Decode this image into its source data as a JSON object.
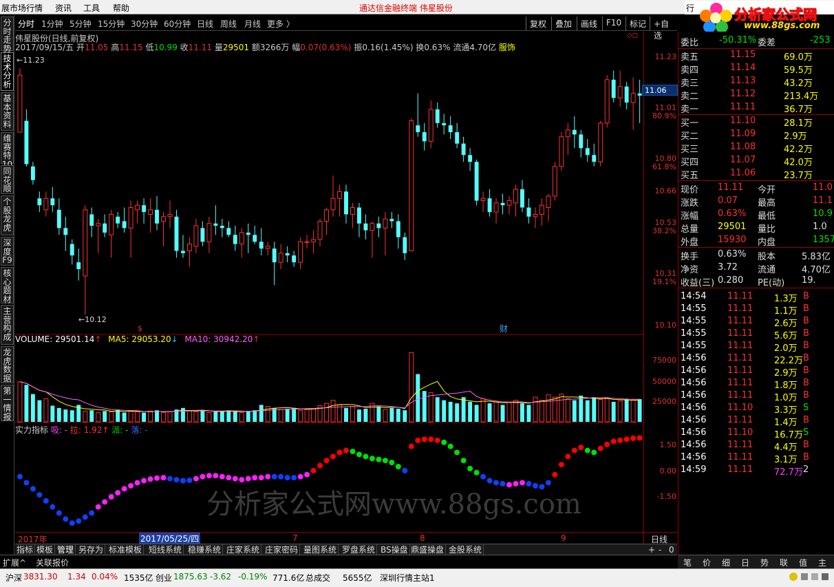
{
  "menubar": {
    "items": [
      "展市场行情",
      "资讯",
      "工具",
      "帮助"
    ],
    "brand": "通达信金融终端  伟星股份",
    "right_label": "行"
  },
  "logo": {
    "title": "分析家公式网",
    "url": "www.88gs.com"
  },
  "left_tabs": [
    "分时走势",
    "技术分析",
    "基本资料",
    "维赛特10",
    "同花顺",
    "个股龙虎",
    "深度F9",
    "核心题材",
    "主营构成",
    "龙虎数据",
    "第一情报"
  ],
  "period_bar": {
    "items": [
      "分时",
      "1分钟",
      "5分钟",
      "15分钟",
      "30分钟",
      "60分钟",
      "日线",
      "周线",
      "月线",
      "更多 〉"
    ],
    "active": "日线",
    "right_items": [
      "复权",
      "叠加",
      "画线",
      "F10",
      "标记",
      "+自选"
    ]
  },
  "chart_header": {
    "title": "伟星股份(日线,前复权)",
    "date": "2017/09/15/五",
    "open_label": "开",
    "open": "11.05",
    "high_label": "高",
    "high": "11.15",
    "low_label": "低",
    "low": "10.99",
    "close_label": "收",
    "close": "11.11",
    "volume_label": "量",
    "volume": "29501",
    "amount": "额3266万",
    "range_label": "幅",
    "range": "0.07(0.63%)",
    "amplitude": "振0.16(1.45%)",
    "turnover": "换0.63%",
    "float_cap": "流通4.70亿",
    "industry": "服饰"
  },
  "chart_data": [
    {
      "type": "candlestick",
      "title": "伟星股份(日线,前复权)",
      "max_label": "11.23",
      "min_label": "10.12",
      "ylim": [
        10.1,
        11.3
      ],
      "axis_ticks": [
        "11.23",
        "11.01",
        "10.80",
        "10.66",
        "10.53",
        "10.31",
        "10.10"
      ],
      "fib_ticks": [
        "80.9%",
        "61.8%",
        "38.2%",
        "19.1%"
      ],
      "current_price": "11.06",
      "markers": [
        "$",
        "财"
      ],
      "ohlc": [
        [
          10.95,
          11.23,
          10.95,
          11.2
        ],
        [
          11.0,
          11.05,
          10.8,
          10.81
        ],
        [
          10.8,
          10.82,
          10.72,
          10.74
        ],
        [
          10.66,
          10.69,
          10.6,
          10.63
        ],
        [
          10.61,
          10.69,
          10.58,
          10.66
        ],
        [
          10.66,
          10.71,
          10.6,
          10.63
        ],
        [
          10.61,
          10.66,
          10.5,
          10.53
        ],
        [
          10.53,
          10.58,
          10.43,
          10.5
        ],
        [
          10.46,
          10.48,
          10.37,
          10.41
        ],
        [
          10.38,
          10.44,
          10.3,
          10.35
        ],
        [
          10.32,
          10.63,
          10.15,
          10.61
        ],
        [
          10.59,
          10.62,
          10.49,
          10.54
        ],
        [
          10.54,
          10.57,
          10.42,
          10.55
        ],
        [
          10.55,
          10.59,
          10.49,
          10.51
        ],
        [
          10.5,
          10.61,
          10.4,
          10.59
        ],
        [
          10.58,
          10.6,
          10.53,
          10.55
        ],
        [
          10.56,
          10.62,
          10.51,
          10.53
        ],
        [
          10.53,
          10.65,
          10.4,
          10.62
        ],
        [
          10.61,
          10.65,
          10.55,
          10.63
        ],
        [
          10.63,
          10.66,
          10.55,
          10.6
        ],
        [
          10.59,
          10.66,
          10.51,
          10.61
        ],
        [
          10.61,
          10.67,
          10.52,
          10.55
        ],
        [
          10.56,
          10.6,
          10.45,
          10.58
        ],
        [
          10.58,
          10.65,
          10.53,
          10.59
        ],
        [
          10.58,
          10.61,
          10.4,
          10.43
        ],
        [
          10.43,
          10.5,
          10.4,
          10.42
        ],
        [
          10.43,
          10.49,
          10.36,
          10.46
        ],
        [
          10.45,
          10.57,
          10.42,
          10.54
        ],
        [
          10.53,
          10.56,
          10.45,
          10.47
        ],
        [
          10.47,
          10.58,
          10.42,
          10.55
        ],
        [
          10.55,
          10.63,
          10.5,
          10.54
        ],
        [
          10.54,
          10.57,
          10.49,
          10.53
        ],
        [
          10.53,
          10.56,
          10.49,
          10.5
        ],
        [
          10.5,
          10.54,
          10.43,
          10.46
        ],
        [
          10.46,
          10.53,
          10.4,
          10.51
        ],
        [
          10.51,
          10.55,
          10.42,
          10.5
        ],
        [
          10.5,
          10.54,
          10.46,
          10.47
        ],
        [
          10.47,
          10.53,
          10.41,
          10.44
        ],
        [
          10.44,
          10.47,
          10.41,
          10.45
        ],
        [
          10.44,
          10.47,
          10.28,
          10.38
        ],
        [
          10.38,
          10.46,
          10.35,
          10.42
        ],
        [
          10.42,
          10.45,
          10.38,
          10.41
        ],
        [
          10.41,
          10.43,
          10.36,
          10.38
        ],
        [
          10.38,
          10.49,
          10.35,
          10.47
        ],
        [
          10.47,
          10.5,
          10.44,
          10.47
        ],
        [
          10.47,
          10.52,
          10.42,
          10.48
        ],
        [
          10.48,
          10.57,
          10.45,
          10.56
        ],
        [
          10.56,
          10.62,
          10.5,
          10.61
        ],
        [
          10.61,
          10.76,
          10.58,
          10.66
        ],
        [
          10.66,
          10.72,
          10.58,
          10.69
        ],
        [
          10.69,
          10.72,
          10.55,
          10.59
        ],
        [
          10.59,
          10.64,
          10.53,
          10.62
        ],
        [
          10.62,
          10.64,
          10.49,
          10.55
        ],
        [
          10.55,
          10.59,
          10.48,
          10.52
        ],
        [
          10.52,
          10.56,
          10.4,
          10.55
        ],
        [
          10.55,
          10.58,
          10.49,
          10.53
        ],
        [
          10.53,
          10.6,
          10.41,
          10.57
        ],
        [
          10.57,
          10.6,
          10.53,
          10.56
        ],
        [
          10.56,
          10.59,
          10.44,
          10.49
        ],
        [
          10.49,
          10.51,
          10.39,
          10.42
        ],
        [
          10.43,
          11.01,
          10.43,
          11.0
        ],
        [
          10.98,
          11.12,
          10.93,
          10.95
        ],
        [
          10.95,
          10.99,
          10.87,
          10.91
        ],
        [
          10.91,
          11.09,
          10.88,
          11.05
        ],
        [
          11.05,
          11.08,
          10.97,
          10.99
        ],
        [
          10.99,
          11.03,
          10.94,
          10.98
        ],
        [
          10.98,
          11.02,
          10.92,
          10.95
        ],
        [
          10.95,
          10.99,
          10.88,
          10.9
        ],
        [
          10.9,
          10.93,
          10.82,
          10.85
        ],
        [
          10.85,
          10.88,
          10.78,
          10.82
        ],
        [
          10.82,
          10.83,
          10.63,
          10.65
        ],
        [
          10.65,
          10.69,
          10.6,
          10.66
        ],
        [
          10.66,
          10.7,
          10.58,
          10.6
        ],
        [
          10.6,
          10.66,
          10.55,
          10.64
        ],
        [
          10.64,
          10.68,
          10.59,
          10.63
        ],
        [
          10.63,
          10.67,
          10.59,
          10.65
        ],
        [
          10.64,
          10.72,
          10.58,
          10.7
        ],
        [
          10.7,
          10.74,
          10.6,
          10.62
        ],
        [
          10.62,
          10.66,
          10.55,
          10.58
        ],
        [
          10.58,
          10.62,
          10.53,
          10.59
        ],
        [
          10.59,
          10.66,
          10.54,
          10.63
        ],
        [
          10.62,
          10.68,
          10.56,
          10.67
        ],
        [
          10.67,
          10.82,
          10.65,
          10.8
        ],
        [
          10.8,
          10.95,
          10.78,
          10.93
        ],
        [
          10.93,
          10.99,
          10.85,
          10.96
        ],
        [
          10.96,
          11.02,
          10.88,
          10.94
        ],
        [
          10.94,
          10.96,
          10.84,
          10.88
        ],
        [
          10.88,
          10.92,
          10.82,
          10.85
        ],
        [
          10.85,
          10.9,
          10.8,
          10.82
        ],
        [
          10.82,
          11.0,
          10.8,
          10.99
        ],
        [
          10.99,
          11.2,
          10.97,
          11.18
        ],
        [
          11.18,
          11.22,
          11.08,
          11.1
        ],
        [
          11.1,
          11.22,
          11.06,
          11.15
        ],
        [
          11.15,
          11.17,
          11.05,
          11.08
        ],
        [
          11.08,
          11.19,
          10.96,
          11.12
        ],
        [
          11.12,
          11.18,
          10.99,
          11.11
        ]
      ]
    },
    {
      "type": "bar",
      "title": "VOLUME",
      "legend": [
        {
          "label": "VOLUME: 29501.14",
          "color": "#ffffff"
        },
        {
          "label": "MA5: 29053.20",
          "color": "#ffff00"
        },
        {
          "label": "MA10: 30942.20",
          "color": "#ff00ff"
        }
      ],
      "axis_ticks": [
        "75000",
        "50000",
        "25000"
      ],
      "ylim": [
        0,
        100000
      ],
      "values": [
        52000,
        48000,
        36000,
        28000,
        30000,
        21000,
        18000,
        16000,
        15000,
        22000,
        14000,
        15000,
        12000,
        14000,
        13000,
        16000,
        12000,
        14000,
        13000,
        12000,
        14000,
        15000,
        12000,
        13000,
        16000,
        18000,
        14000,
        13000,
        15000,
        12000,
        13000,
        14000,
        15000,
        13000,
        12000,
        14000,
        15000,
        22000,
        20000,
        18000,
        16000,
        17000,
        18000,
        15000,
        16000,
        17000,
        21000,
        24000,
        28000,
        22000,
        18000,
        20000,
        16000,
        17000,
        24000,
        20000,
        16000,
        18000,
        17000,
        15000,
        90000,
        62000,
        40000,
        38000,
        32000,
        28000,
        26000,
        24000,
        32000,
        26000,
        22000,
        30000,
        24000,
        26000,
        22000,
        25000,
        28000,
        24000,
        22000,
        32000,
        28000,
        35000,
        32000,
        36000,
        30000,
        28000,
        34000,
        28000,
        32000,
        29000,
        30000,
        26000,
        27000,
        30000,
        28000,
        29501
      ]
    },
    {
      "type": "scatter",
      "title": "实力指标",
      "legend": [
        "吸: -",
        "拉: 1.92",
        "派: -",
        "落: -"
      ],
      "axis_ticks": [
        "1.50",
        "0.00",
        "-1.50"
      ],
      "ylim": [
        -2.5,
        2.0
      ],
      "values": [
        0.0,
        -0.3,
        -0.6,
        -0.9,
        -1.2,
        -1.5,
        -1.8,
        -2.1,
        -2.3,
        -2.2,
        -2.0,
        -1.8,
        -1.5,
        -1.25,
        -1.0,
        -0.8,
        -0.6,
        -0.45,
        -0.3,
        -0.2,
        -0.12,
        -0.07,
        -0.05,
        -0.1,
        -0.15,
        -0.2,
        -0.18,
        -0.1,
        0.0,
        0.05,
        0.05,
        0.0,
        -0.05,
        -0.1,
        -0.15,
        -0.1,
        -0.05,
        -0.05,
        0.0,
        0.0,
        0.0,
        -0.05,
        -0.05,
        0.0,
        0.1,
        0.3,
        0.55,
        0.8,
        1.0,
        1.2,
        1.3,
        1.25,
        1.1,
        1.0,
        0.9,
        0.85,
        0.8,
        0.7,
        0.5,
        0.3,
        1.5,
        1.8,
        1.85,
        1.85,
        1.8,
        1.7,
        1.5,
        1.2,
        0.8,
        0.4,
        0.2,
        0.0,
        -0.2,
        -0.3,
        -0.35,
        -0.4,
        -0.35,
        -0.3,
        -0.35,
        -0.45,
        -0.5,
        -0.3,
        0.1,
        0.6,
        1.0,
        1.3,
        1.45,
        1.3,
        1.2,
        1.4,
        1.6,
        1.75,
        1.8,
        1.85,
        1.9,
        1.92
      ],
      "color_codes": [
        2,
        2,
        2,
        2,
        2,
        2,
        2,
        2,
        2,
        2,
        2,
        2,
        3,
        3,
        3,
        3,
        3,
        3,
        3,
        3,
        3,
        3,
        3,
        2,
        2,
        2,
        2,
        3,
        3,
        3,
        3,
        3,
        3,
        3,
        3,
        3,
        3,
        3,
        3,
        2,
        2,
        2,
        2,
        3,
        3,
        0,
        0,
        0,
        0,
        0,
        0,
        1,
        1,
        1,
        1,
        1,
        1,
        1,
        1,
        2,
        0,
        0,
        0,
        0,
        0,
        1,
        1,
        1,
        1,
        1,
        1,
        2,
        2,
        2,
        2,
        3,
        3,
        3,
        2,
        2,
        2,
        2,
        0,
        0,
        0,
        0,
        0,
        1,
        1,
        0,
        0,
        0,
        0,
        0,
        0,
        0
      ],
      "palette": [
        "#ff0000",
        "#00e000",
        "#1040ff",
        "#ff20ff"
      ]
    }
  ],
  "date_bar": {
    "labels": [
      "2017年",
      "2017/05/25/四",
      "7",
      "8",
      "9"
    ],
    "period": "日线"
  },
  "bottom_tabs": [
    "指标",
    "模板",
    "管理",
    "另存为",
    "标准模板",
    "短线系统",
    "稳赚系统",
    "庄家系统",
    "庄家密码",
    "量图系统",
    "罗盘系统",
    "BS操盘",
    "鼎盛操盘",
    "金股系统"
  ],
  "zoom_controls": [
    "+",
    "-",
    "0"
  ],
  "ext_tabs": [
    "扩展^",
    "关联报价"
  ],
  "watermark": "分析家公式网www.88gs.com",
  "right_panel": {
    "weibi": {
      "label": "委比",
      "value": "-50.31%",
      "label2": "委差",
      "value2": "-253"
    },
    "asks": [
      {
        "label": "卖五",
        "price": "11.15",
        "vol": "69.0万"
      },
      {
        "label": "卖四",
        "price": "11.14",
        "vol": "59.5万"
      },
      {
        "label": "卖三",
        "price": "11.13",
        "vol": "43.2万"
      },
      {
        "label": "卖二",
        "price": "11.12",
        "vol": "213.4万"
      },
      {
        "label": "卖一",
        "price": "11.11",
        "vol": "36.7万"
      }
    ],
    "bids": [
      {
        "label": "买一",
        "price": "11.10",
        "vol": "28.1万"
      },
      {
        "label": "买二",
        "price": "11.09",
        "vol": "2.9万"
      },
      {
        "label": "买三",
        "price": "11.08",
        "vol": "42.2万"
      },
      {
        "label": "买四",
        "price": "11.07",
        "vol": "42.0万"
      },
      {
        "label": "买五",
        "price": "11.06",
        "vol": "23.7万"
      }
    ],
    "stats": [
      {
        "l1": "现价",
        "v1": "11.11",
        "l2": "今开",
        "v2": "11.0",
        "c1": "#ff3030",
        "c2": "#ff3030"
      },
      {
        "l1": "涨跌",
        "v1": "0.07",
        "l2": "最高",
        "v2": "11.1",
        "c1": "#ff3030",
        "c2": "#ff3030"
      },
      {
        "l1": "涨幅",
        "v1": "0.63%",
        "l2": "最低",
        "v2": "10.9",
        "c1": "#ff3030",
        "c2": "#00e000"
      },
      {
        "l1": "总量",
        "v1": "29501",
        "l2": "量比",
        "v2": "1.0",
        "c1": "#ffff00",
        "c2": "#e0e0e0"
      },
      {
        "l1": "外盘",
        "v1": "15930",
        "l2": "内盘",
        "v2": "1357",
        "c1": "#ff3030",
        "c2": "#00e000"
      }
    ],
    "stats2": [
      {
        "l1": "换手",
        "v1": "0.63%",
        "l2": "股本",
        "v2": "5.83亿"
      },
      {
        "l1": "净资",
        "v1": "3.72",
        "l2": "流通",
        "v2": "4.70亿"
      },
      {
        "l1": "收益(三)",
        "v1": "0.280",
        "l2": "PE(动)",
        "v2": "19."
      }
    ],
    "ticks": [
      {
        "t": "14:54",
        "p": "11.11",
        "v": "1.3万",
        "s": "B"
      },
      {
        "t": "14:55",
        "p": "11.11",
        "v": "1.1万",
        "s": "B"
      },
      {
        "t": "14:55",
        "p": "11.11",
        "v": "2.6万",
        "s": "B"
      },
      {
        "t": "14:55",
        "p": "11.11",
        "v": "5.6万",
        "s": "B"
      },
      {
        "t": "14:55",
        "p": "11.11",
        "v": "2.0万",
        "s": "B"
      },
      {
        "t": "14:56",
        "p": "11.11",
        "v": "22.2万",
        "s": "B"
      },
      {
        "t": "14:56",
        "p": "11.11",
        "v": "2.9万",
        "s": "B"
      },
      {
        "t": "14:56",
        "p": "11.11",
        "v": "1.8万",
        "s": "B"
      },
      {
        "t": "14:56",
        "p": "11.11",
        "v": "1.0万",
        "s": "B"
      },
      {
        "t": "14:56",
        "p": "11.10",
        "v": "3.3万",
        "s": "S"
      },
      {
        "t": "14:56",
        "p": "11.11",
        "v": "1.4万",
        "s": "B"
      },
      {
        "t": "14:56",
        "p": "11.10",
        "v": "16.7万",
        "s": "S"
      },
      {
        "t": "14:56",
        "p": "11.11",
        "v": "4.4万",
        "s": "B"
      },
      {
        "t": "14:56",
        "p": "11.11",
        "v": "3.1万",
        "s": "B"
      },
      {
        "t": "14:59",
        "p": "11.11",
        "v": "72.7万",
        "s": "2"
      }
    ],
    "bottom_tabs": [
      "笔",
      "价",
      "细",
      "日",
      "势",
      "联",
      "值",
      "主"
    ]
  },
  "status": {
    "index1_name": "沪深",
    "index1": "3831.30",
    "index1_chg": "1.34",
    "index1_pct": "0.04%",
    "index1_amt": "1535亿",
    "index2_name": "创业",
    "index2": "1875.63",
    "index2_chg": "-3.62",
    "index2_pct": "-0.19%",
    "index2_amt": "771.6亿",
    "total_label": "总成交",
    "total": "5655亿",
    "server": "深圳行情主站1"
  }
}
